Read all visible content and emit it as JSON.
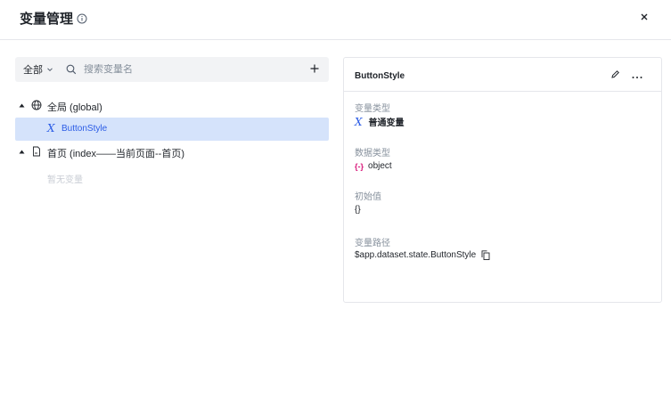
{
  "header": {
    "title": "变量管理",
    "icons": {
      "info": "info-circle-icon",
      "close": "close-icon"
    }
  },
  "toolbar": {
    "scope_label": "全部",
    "search_placeholder": "搜索变量名",
    "icons": {
      "chevron": "chevron-down-icon",
      "search": "search-icon",
      "add": "plus-icon"
    }
  },
  "tree": {
    "groups": [
      {
        "label": "全局 (global)",
        "icon": "globe-icon",
        "expanded": true,
        "items": [
          {
            "label": "ButtonStyle",
            "icon": "variable-x-icon",
            "selected": true
          }
        ]
      },
      {
        "label": "首页 (index——当前页面--首页)",
        "icon": "page-icon",
        "expanded": true,
        "empty_text": "暂无变量"
      }
    ]
  },
  "detail": {
    "title": "ButtonStyle",
    "icons": {
      "edit": "edit-pencil-icon",
      "more": "more-dots-icon",
      "copy": "copy-icon"
    },
    "fields": {
      "var_type_label": "变量类型",
      "var_type_value": "普通变量",
      "data_type_label": "数据类型",
      "data_type_badge": "{-}",
      "data_type_value": "object",
      "initial_label": "初始值",
      "initial_value": "{}",
      "path_label": "变量路径",
      "path_value": "$app.dataset.state.ButtonStyle"
    }
  },
  "colors": {
    "accent": "#2b5ce6",
    "selected_bg": "#d5e3fb",
    "object_badge": "#d91a7c",
    "muted_text": "#86909c",
    "border": "#e5e6eb"
  }
}
